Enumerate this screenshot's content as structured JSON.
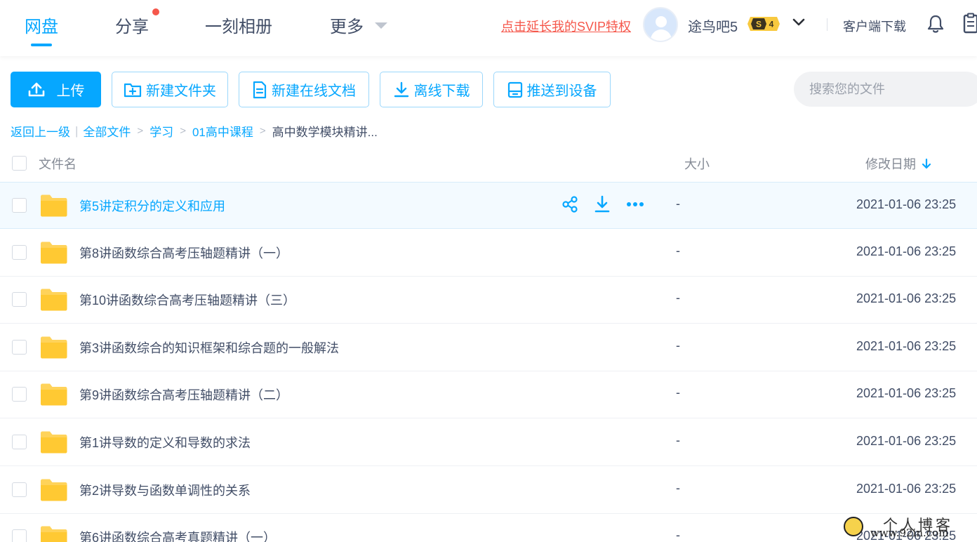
{
  "nav": {
    "items": [
      {
        "label": "网盘",
        "active": true
      },
      {
        "label": "分享",
        "has_dot": true
      },
      {
        "label": "一刻相册"
      },
      {
        "label": "更多"
      }
    ],
    "svip_link": "点击延长我的SVIP特权",
    "username": "途鸟吧5",
    "vip_level": "4",
    "client_download": "客户端下载"
  },
  "toolbar": {
    "upload": "上传",
    "new_folder": "新建文件夹",
    "new_doc": "新建在线文档",
    "offline_download": "离线下载",
    "push_device": "推送到设备",
    "search_placeholder": "搜索您的文件"
  },
  "breadcrumb": {
    "back": "返回上一级",
    "items": [
      "全部文件",
      "学习",
      "01高中课程"
    ],
    "current": "高中数学模块精讲..."
  },
  "table": {
    "headers": {
      "name": "文件名",
      "size": "大小",
      "date": "修改日期"
    },
    "rows": [
      {
        "name": "第5讲定积分的定义和应用",
        "size": "-",
        "date": "2021-01-06 23:25",
        "hover": true
      },
      {
        "name": "第8讲函数综合高考压轴题精讲（一）",
        "size": "-",
        "date": "2021-01-06 23:25"
      },
      {
        "name": "第10讲函数综合高考压轴题精讲（三）",
        "size": "-",
        "date": "2021-01-06 23:25"
      },
      {
        "name": "第3讲函数综合的知识框架和综合题的一般解法",
        "size": "-",
        "date": "2021-01-06 23:25"
      },
      {
        "name": "第9讲函数综合高考压轴题精讲（二）",
        "size": "-",
        "date": "2021-01-06 23:25"
      },
      {
        "name": "第1讲导数的定义和导数的求法",
        "size": "-",
        "date": "2021-01-06 23:25"
      },
      {
        "name": "第2讲导数与函数单调性的关系",
        "size": "-",
        "date": "2021-01-06 23:25"
      },
      {
        "name": "第6讲函数综合高考真题精讲（一）",
        "size": "-",
        "date": "2021-01-06 23:25"
      }
    ]
  },
  "watermark": {
    "title": "个人博客",
    "url": "www.92in.com"
  },
  "colors": {
    "accent": "#06a7ff",
    "text": "#424e67",
    "muted": "#848a95",
    "alert": "#f5574b",
    "folder": "#ffd35a"
  }
}
